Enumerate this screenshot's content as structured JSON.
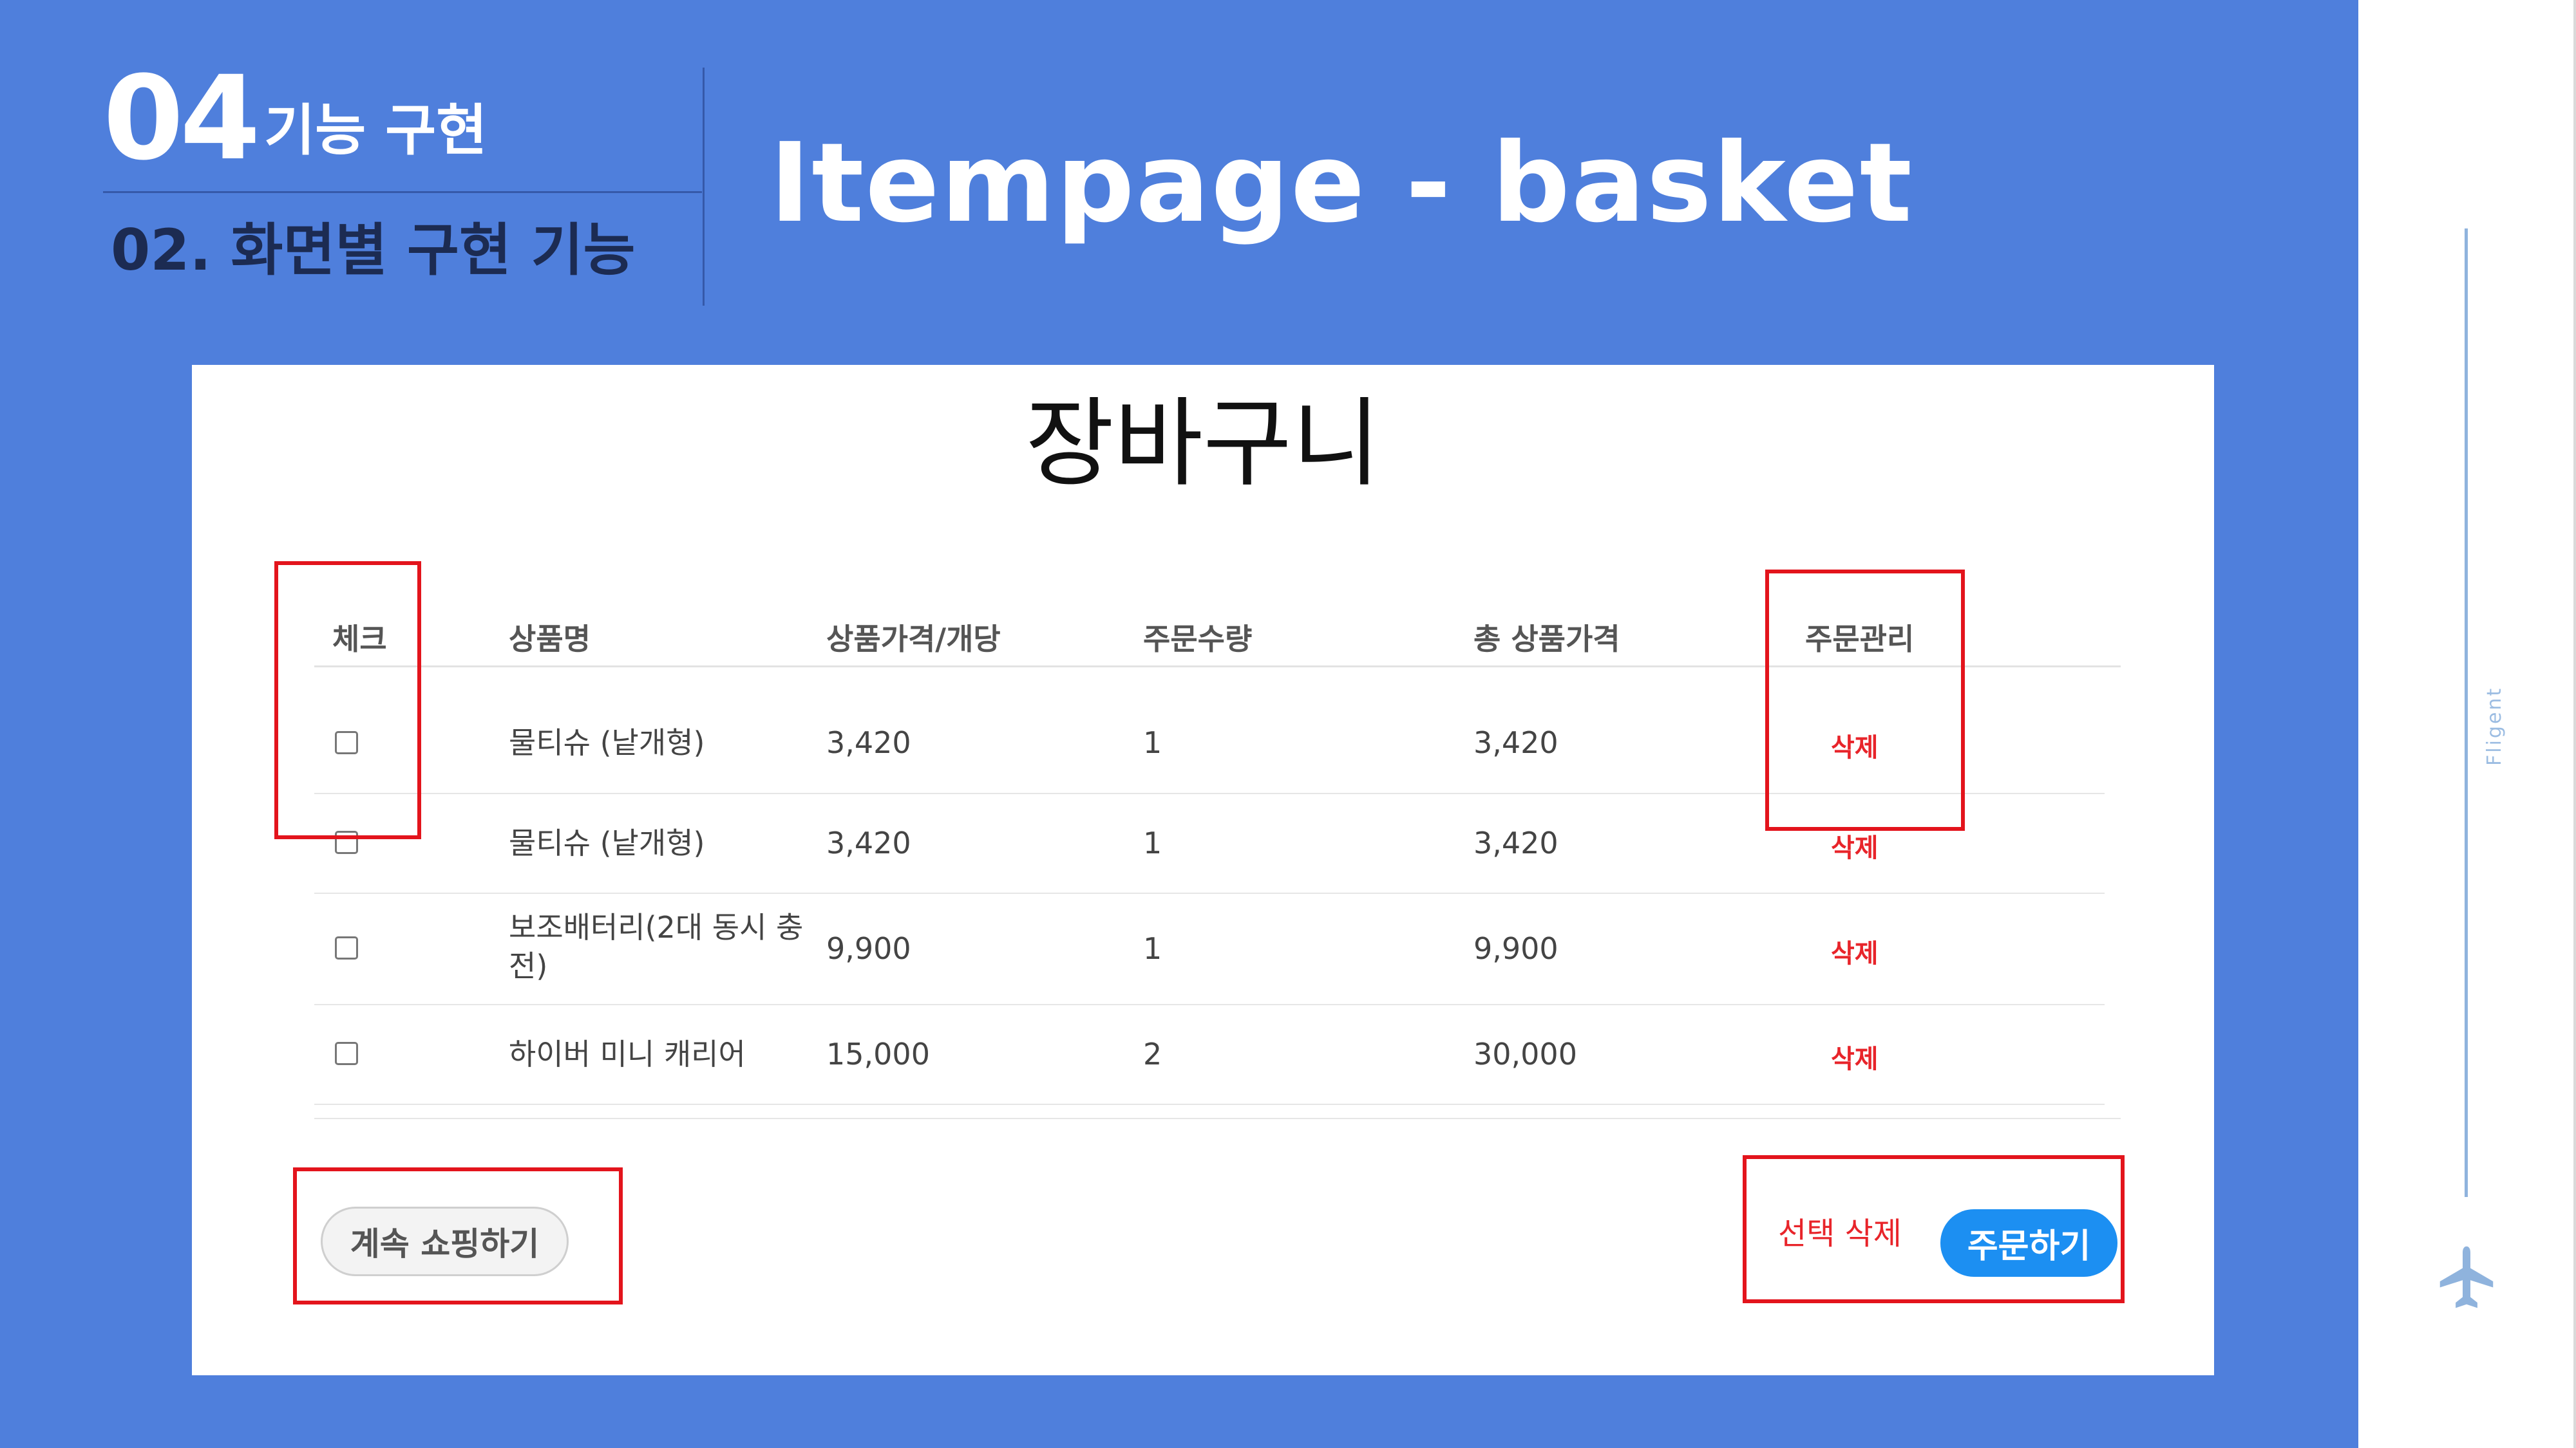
{
  "header": {
    "section_number": "04",
    "section_title": "기능 구현",
    "subsection": "02. 화면별 구현 기능",
    "page_title": "Itempage - basket"
  },
  "side": {
    "vertical_label": "Fligent",
    "icon": "airplane-icon",
    "line_color": "#8fb3dd"
  },
  "colors": {
    "slide_background": "#4f7fdc",
    "highlight_box": "#e3141c",
    "delete_text": "#e8242a",
    "order_button": "#1c8ff2"
  },
  "basket": {
    "title": "장바구니",
    "columns": [
      "체크",
      "상품명",
      "상품가격/개당",
      "주문수량",
      "총 상품가격",
      "주문관리"
    ],
    "rows": [
      {
        "name": "물티슈 (낱개형)",
        "price": "3,420",
        "qty": "1",
        "total": "3,420",
        "action": "삭제"
      },
      {
        "name": "물티슈 (낱개형)",
        "price": "3,420",
        "qty": "1",
        "total": "3,420",
        "action": "삭제"
      },
      {
        "name": "보조배터리(2대 동시 충전)",
        "price": "9,900",
        "qty": "1",
        "total": "9,900",
        "action": "삭제"
      },
      {
        "name": "하이버 미니 캐리어",
        "price": "15,000",
        "qty": "2",
        "total": "30,000",
        "action": "삭제"
      }
    ],
    "continue_label": "계속 쇼핑하기",
    "select_delete_label": "선택 삭제",
    "order_label": "주문하기"
  }
}
